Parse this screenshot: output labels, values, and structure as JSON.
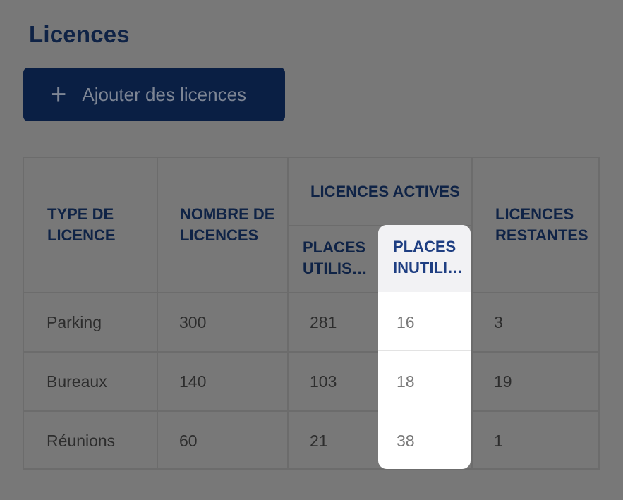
{
  "page": {
    "title": "Licences"
  },
  "actions": {
    "add_label": "Ajouter des licences",
    "add_icon": "plus-icon"
  },
  "table": {
    "headers": {
      "type": "TYPE DE LICENCE",
      "type_l1": "TYPE DE",
      "type_l2": "LICENCE",
      "count_l1": "NOMBRE DE",
      "count_l2": "LICENCES",
      "active_group": "LICENCES ACTIVES",
      "used_l1": "PLACES",
      "used_l2": "UTILIS…",
      "unused_l1": "PLACES",
      "unused_l2": "INUTILI…",
      "remaining_l1": "LICENCES",
      "remaining_l2": "RESTANTES"
    },
    "rows": [
      {
        "type": "Parking",
        "count": "300",
        "used": "281",
        "unused": "16",
        "remaining": "3"
      },
      {
        "type": "Bureaux",
        "count": "140",
        "used": "103",
        "unused": "18",
        "remaining": "19"
      },
      {
        "type": "Réunions",
        "count": "60",
        "used": "21",
        "unused": "38",
        "remaining": "1"
      }
    ]
  },
  "colors": {
    "overlay": "#787878",
    "primary": "#0a1f44",
    "highlight_header": "#1f3f82"
  }
}
